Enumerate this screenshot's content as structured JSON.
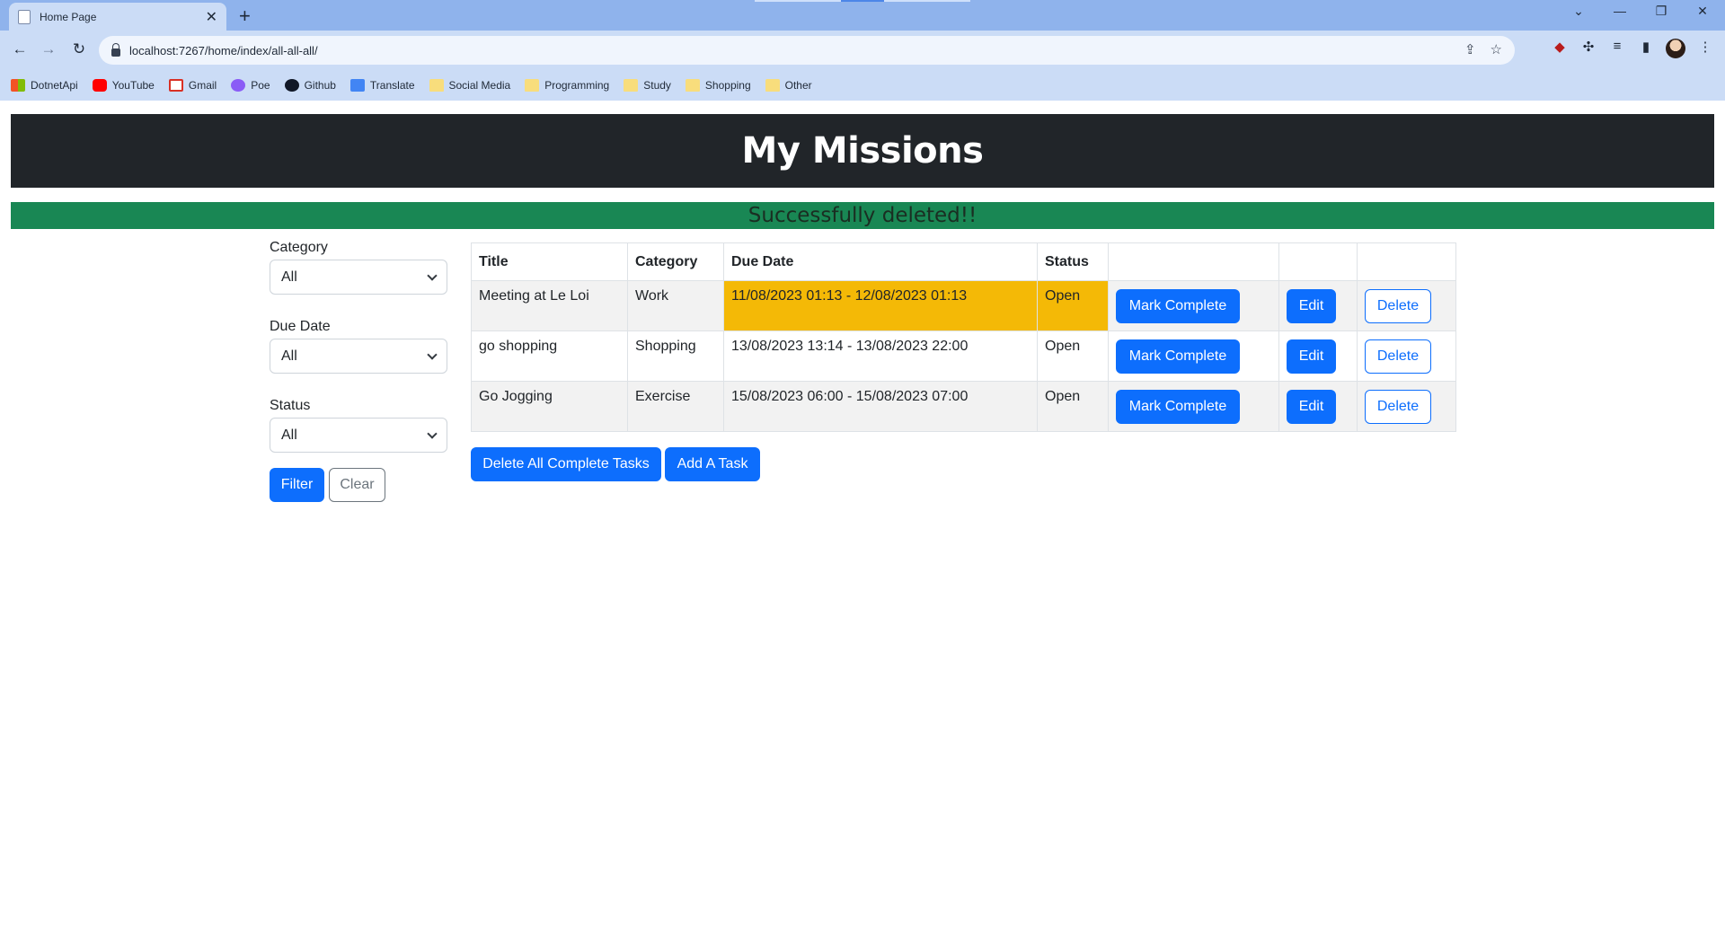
{
  "browser": {
    "tab_title": "Home Page",
    "tab_close": "✕",
    "new_tab": "+",
    "url": "localhost:7267/home/index/all-all-all/",
    "bookmarks": [
      {
        "label": "DotnetApi",
        "icon": "ms"
      },
      {
        "label": "YouTube",
        "icon": "yt"
      },
      {
        "label": "Gmail",
        "icon": "gm"
      },
      {
        "label": "Poe",
        "icon": "poe"
      },
      {
        "label": "Github",
        "icon": "gh"
      },
      {
        "label": "Translate",
        "icon": "tr"
      },
      {
        "label": "Social Media",
        "icon": "folder"
      },
      {
        "label": "Programming",
        "icon": "folder"
      },
      {
        "label": "Study",
        "icon": "folder"
      },
      {
        "label": "Shopping",
        "icon": "folder"
      },
      {
        "label": "Other",
        "icon": "folder"
      }
    ]
  },
  "header": {
    "title": "My Missions"
  },
  "alert": {
    "message": "Successfully deleted!!",
    "color": "#198754"
  },
  "filters": {
    "category": {
      "label": "Category",
      "value": "All"
    },
    "due_date": {
      "label": "Due Date",
      "value": "All"
    },
    "status": {
      "label": "Status",
      "value": "All"
    },
    "filter_label": "Filter",
    "clear_label": "Clear"
  },
  "table": {
    "headers": [
      "Title",
      "Category",
      "Due Date",
      "Status",
      "",
      "",
      ""
    ],
    "rows": [
      {
        "title": "Meeting at Le Loi",
        "category": "Work",
        "due": "11/08/2023 01:13 - 12/08/2023 01:13",
        "status": "Open",
        "overdue": true
      },
      {
        "title": "go shopping",
        "category": "Shopping",
        "due": "13/08/2023 13:14 - 13/08/2023 22:00",
        "status": "Open",
        "overdue": false
      },
      {
        "title": "Go Jogging",
        "category": "Exercise",
        "due": "15/08/2023 06:00 - 15/08/2023 07:00",
        "status": "Open",
        "overdue": false
      }
    ],
    "mark_complete_label": "Mark Complete",
    "edit_label": "Edit",
    "delete_label": "Delete",
    "overdue_color": "#f4b906"
  },
  "actions": {
    "delete_all_label": "Delete All Complete Tasks",
    "add_task_label": "Add A Task"
  },
  "colors": {
    "primary": "#0d6efd",
    "banner": "#212529"
  }
}
